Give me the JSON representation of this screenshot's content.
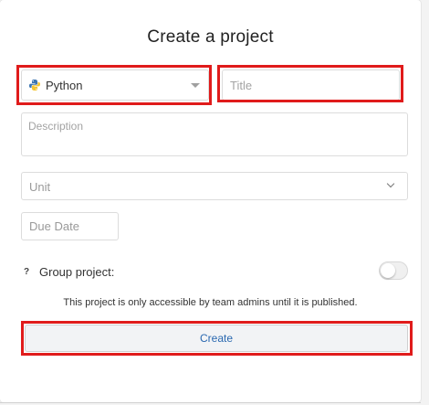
{
  "dialog": {
    "title": "Create a project",
    "language": {
      "value": "Python",
      "icon": "python-logo-icon"
    },
    "title_field": {
      "placeholder": "Title",
      "value": ""
    },
    "description_field": {
      "placeholder": "Description",
      "value": ""
    },
    "unit_select": {
      "placeholder": "Unit"
    },
    "due_date_field": {
      "placeholder": "Due Date",
      "value": ""
    },
    "group_project": {
      "label": "Group project:",
      "help_icon": "?",
      "enabled": false
    },
    "note": "This project is only accessible by team admins until it is published.",
    "create_label": "Create"
  },
  "colors": {
    "highlight": "#e01b1b",
    "create_text": "#2a68b0",
    "border": "#dcdcdc"
  }
}
